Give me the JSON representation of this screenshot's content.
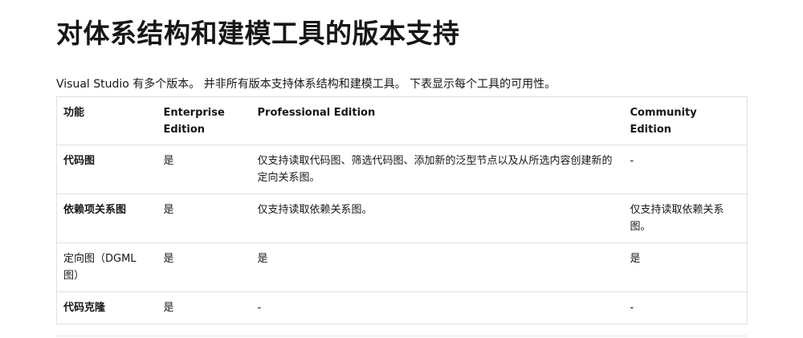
{
  "page": {
    "title": "对体系结构和建模工具的版本支持",
    "intro": "Visual Studio 有多个版本。 并非所有版本支持体系结构和建模工具。 下表显示每个工具的可用性。"
  },
  "table": {
    "headers": [
      "功能",
      "Enterprise Edition",
      "Professional Edition",
      "Community Edition"
    ],
    "rows": [
      {
        "feature": "代码图",
        "enterprise": "是",
        "professional": "仅支持读取代码图、筛选代码图、添加新的泛型节点以及从所选内容创建新的定向关系图。",
        "community": "-"
      },
      {
        "feature": "依赖项关系图",
        "enterprise": "是",
        "professional": "仅支持读取依赖关系图。",
        "community": "仅支持读取依赖关系图。"
      },
      {
        "feature": "定向图（DGML 图）",
        "enterprise": "是",
        "professional": "是",
        "community": "是"
      },
      {
        "feature": "代码克隆",
        "enterprise": "是",
        "professional": "-",
        "community": "-"
      }
    ]
  }
}
